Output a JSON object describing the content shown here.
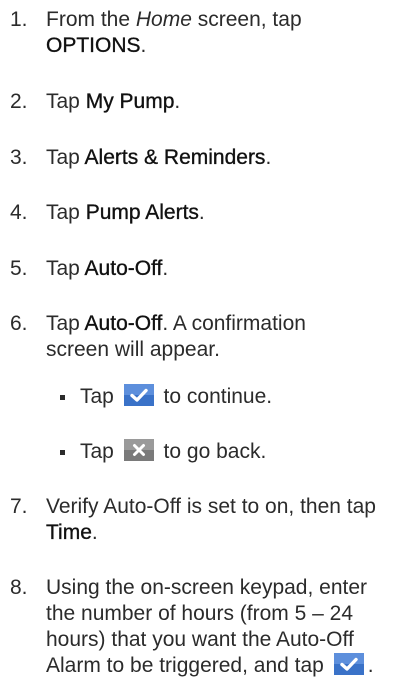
{
  "steps": [
    {
      "num": "1.",
      "pre": "From the ",
      "em": "Home",
      "mid": " screen, tap",
      "bold": "OPTIONS",
      "post": "."
    },
    {
      "num": "2.",
      "pre": "Tap ",
      "bold": "My Pump",
      "post": "."
    },
    {
      "num": "3.",
      "pre": "Tap ",
      "bold": "Alerts & Reminders",
      "post": "."
    },
    {
      "num": "4.",
      "pre": "Tap ",
      "bold": "Pump Alerts",
      "post": "."
    },
    {
      "num": "5.",
      "pre": "Tap ",
      "bold": "Auto-Off",
      "post": "."
    },
    {
      "num": "6.",
      "pre": "Tap ",
      "bold": "Auto-Off",
      "post": ". A confirmation",
      "line2": "screen will appear."
    },
    {
      "num": "7.",
      "line1": "Verify Auto-Off is set to on, then tap",
      "bold": "Time",
      "post": "."
    },
    {
      "num": "8.",
      "line1": "Using the on-screen keypad, enter",
      "line2": "the number of hours (from 5 – 24",
      "line3": "hours) that you want the Auto-Off",
      "line4": "Alarm to be triggered, and tap",
      "post": "."
    }
  ],
  "bullets": [
    {
      "pre": "Tap",
      "post": "to continue.",
      "icon": "check-icon"
    },
    {
      "pre": "Tap",
      "post": "to go back.",
      "icon": "x-icon"
    }
  ],
  "colors": {
    "check_button": "#3a72c8",
    "x_button": "#808080"
  }
}
